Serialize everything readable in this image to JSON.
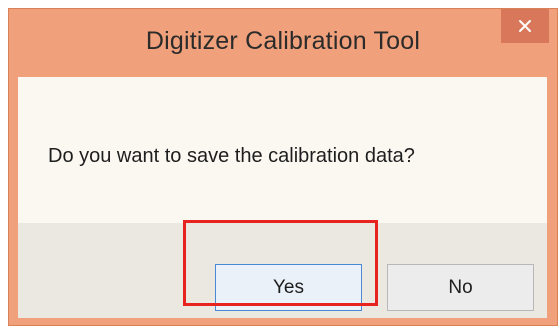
{
  "dialog": {
    "title": "Digitizer Calibration Tool",
    "message": "Do you want to save the calibration data?",
    "buttons": {
      "yes_label": "Yes",
      "no_label": "No"
    },
    "close_icon": "close-icon",
    "highlighted_button": "Yes"
  },
  "colors": {
    "titlebar": "#f0a07a",
    "close_button": "#d9775a",
    "highlight": "#e8231f",
    "focused_button_border": "#4a8ad4"
  }
}
